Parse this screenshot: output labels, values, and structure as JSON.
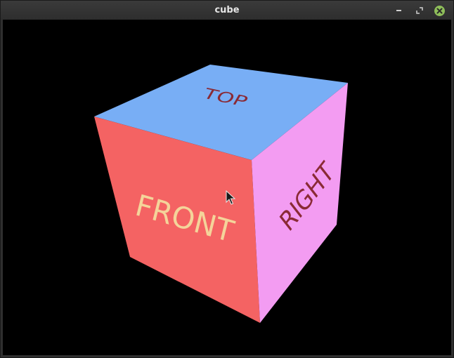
{
  "window": {
    "title": "cube"
  },
  "scene": {
    "faces": {
      "top": {
        "label": "TOP",
        "color": "#78aef5",
        "text_color": "#8a2a35"
      },
      "front": {
        "label": "FRONT",
        "color": "#f46363",
        "text_color": "#f4d49a"
      },
      "right": {
        "label": "RIGHT",
        "color": "#f39cf2",
        "text_color": "#8a2a35"
      }
    },
    "background_color": "#000000"
  },
  "icons": {
    "minimize": "minimize-icon",
    "maximize": "maximize-icon",
    "close": "close-icon",
    "cursor": "mouse-pointer-icon"
  }
}
